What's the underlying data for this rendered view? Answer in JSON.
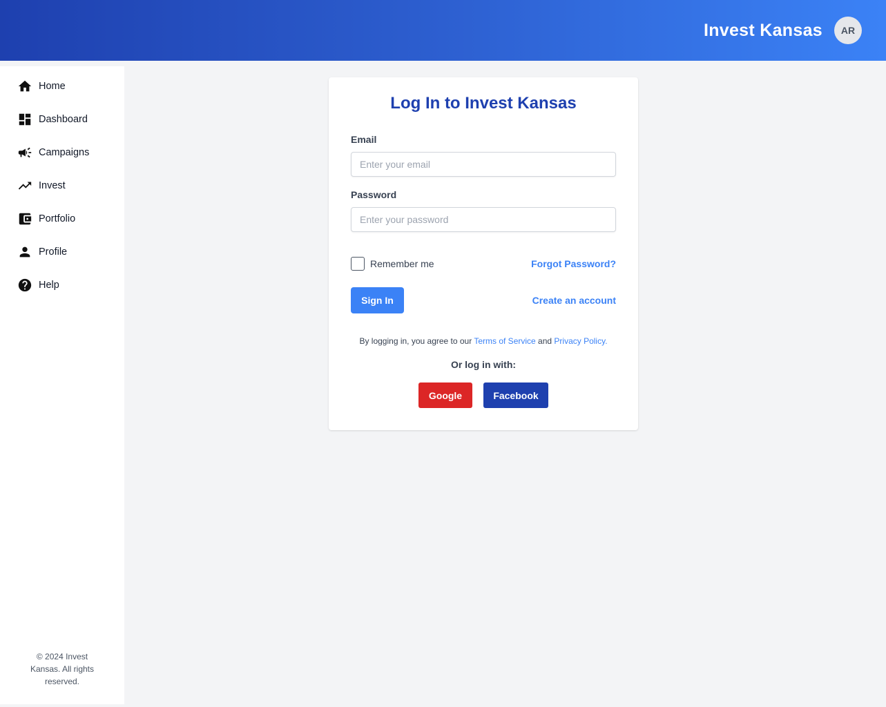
{
  "header": {
    "brand": "Invest Kansas",
    "avatar_initials": "AR"
  },
  "sidebar": {
    "items": [
      {
        "label": "Home",
        "icon": "home-icon"
      },
      {
        "label": "Dashboard",
        "icon": "dashboard-icon"
      },
      {
        "label": "Campaigns",
        "icon": "campaign-icon"
      },
      {
        "label": "Invest",
        "icon": "trending-up-icon"
      },
      {
        "label": "Portfolio",
        "icon": "wallet-icon"
      },
      {
        "label": "Profile",
        "icon": "person-icon"
      },
      {
        "label": "Help",
        "icon": "help-icon"
      }
    ],
    "footer": "© 2024 Invest Kansas. All rights reserved."
  },
  "login": {
    "title": "Log In to Invest Kansas",
    "email_label": "Email",
    "email_placeholder": "Enter your email",
    "email_value": "",
    "password_label": "Password",
    "password_placeholder": "Enter your password",
    "password_value": "",
    "remember_label": "Remember me",
    "remember_checked": false,
    "forgot_link": "Forgot Password?",
    "signin_label": "Sign In",
    "create_account_link": "Create an account",
    "terms_prefix": "By logging in, you agree to our ",
    "terms_link": "Terms of Service",
    "terms_and": " and ",
    "privacy_link": "Privacy Policy",
    "terms_suffix": ".",
    "or_text": "Or log in with:",
    "google_label": "Google",
    "facebook_label": "Facebook"
  },
  "colors": {
    "primary": "#3b82f6",
    "title_blue": "#1e40af",
    "google_red": "#dc2626",
    "facebook_blue": "#1e40af"
  }
}
